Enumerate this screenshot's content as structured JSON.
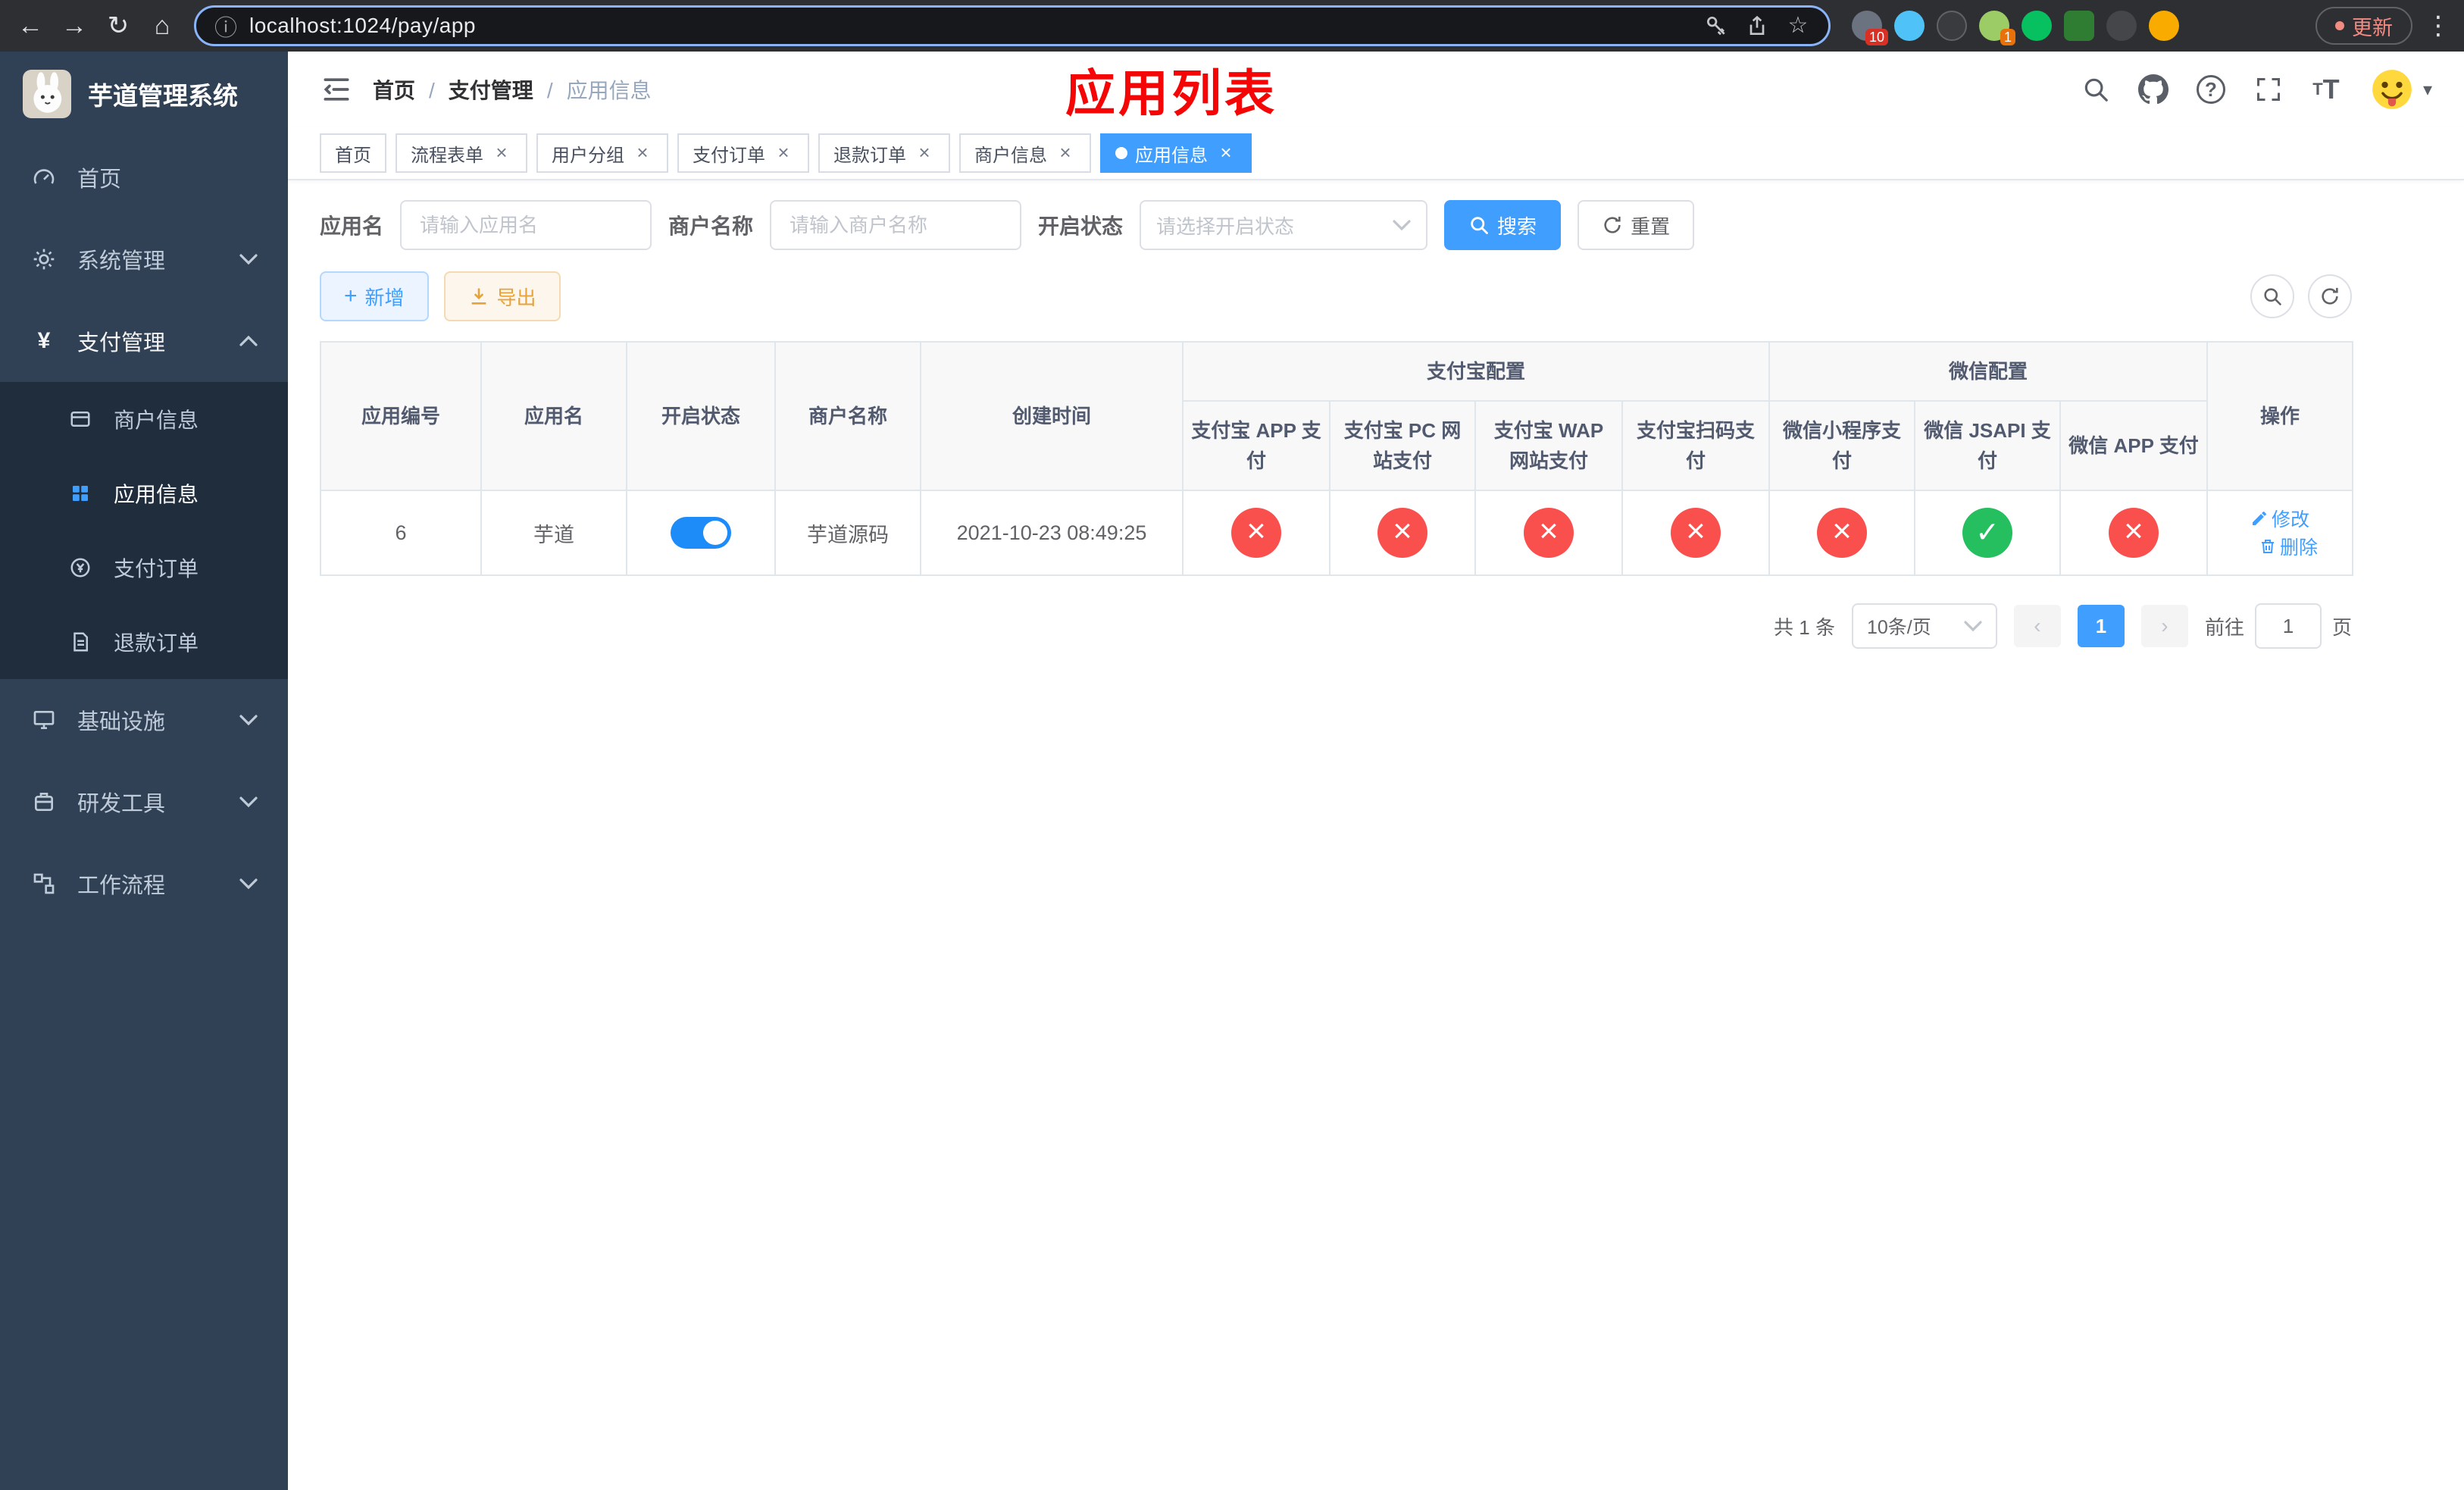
{
  "colors": {
    "primary": "#409eff",
    "danger": "#f9504e",
    "success": "#26bf5f",
    "sidebar_bg": "#304156",
    "annotation_red": "#f40606"
  },
  "browser": {
    "url": "localhost:1024/pay/app",
    "update_label": "更新",
    "ext_badge_1": "10",
    "ext_badge_2": "1"
  },
  "sidebar": {
    "logo_title": "芋道管理系统",
    "home": "首页",
    "system": "系统管理",
    "payment": "支付管理",
    "merchant_info": "商户信息",
    "app_info": "应用信息",
    "pay_order": "支付订单",
    "refund_order": "退款订单",
    "infra": "基础设施",
    "dev_tools": "研发工具",
    "workflow": "工作流程"
  },
  "header": {
    "breadcrumb": [
      "首页",
      "支付管理",
      "应用信息"
    ],
    "annotation": "应用列表"
  },
  "tabs": [
    {
      "label": "首页"
    },
    {
      "label": "流程表单"
    },
    {
      "label": "用户分组"
    },
    {
      "label": "支付订单"
    },
    {
      "label": "退款订单"
    },
    {
      "label": "商户信息"
    },
    {
      "label": "应用信息"
    }
  ],
  "filters": {
    "app_name_label": "应用名",
    "app_name_placeholder": "请输入应用名",
    "merchant_label": "商户名称",
    "merchant_placeholder": "请输入商户名称",
    "status_label": "开启状态",
    "status_placeholder": "请选择开启状态",
    "search_button": "搜索",
    "reset_button": "重置"
  },
  "toolbar": {
    "add_button": "新增",
    "export_button": "导出"
  },
  "table": {
    "groups": {
      "alipay": "支付宝配置",
      "wechat": "微信配置"
    },
    "columns": {
      "app_id": "应用编号",
      "app_name": "应用名",
      "status": "开启状态",
      "merchant_name": "商户名称",
      "create_time": "创建时间",
      "alipay_app": "支付宝 APP 支付",
      "alipay_pc": "支付宝 PC 网站支付",
      "alipay_wap": "支付宝 WAP 网站支付",
      "alipay_qr": "支付宝扫码支付",
      "wechat_lite": "微信小程序支付",
      "wechat_jsapi": "微信 JSAPI 支付",
      "wechat_app": "微信 APP 支付",
      "actions": "操作"
    },
    "row": {
      "app_id": "6",
      "app_name": "芋道",
      "status": "on",
      "merchant_name": "芋道源码",
      "create_time": "2021-10-23 08:49:25",
      "configs": [
        "cross",
        "cross",
        "cross",
        "cross",
        "cross",
        "check",
        "cross"
      ],
      "edit_label": "修改",
      "delete_label": "删除"
    }
  },
  "pagination": {
    "total_text": "共 1 条",
    "page_size": "10条/页",
    "current_page": "1",
    "goto_label": "前往",
    "goto_value": "1",
    "goto_suffix": "页"
  }
}
